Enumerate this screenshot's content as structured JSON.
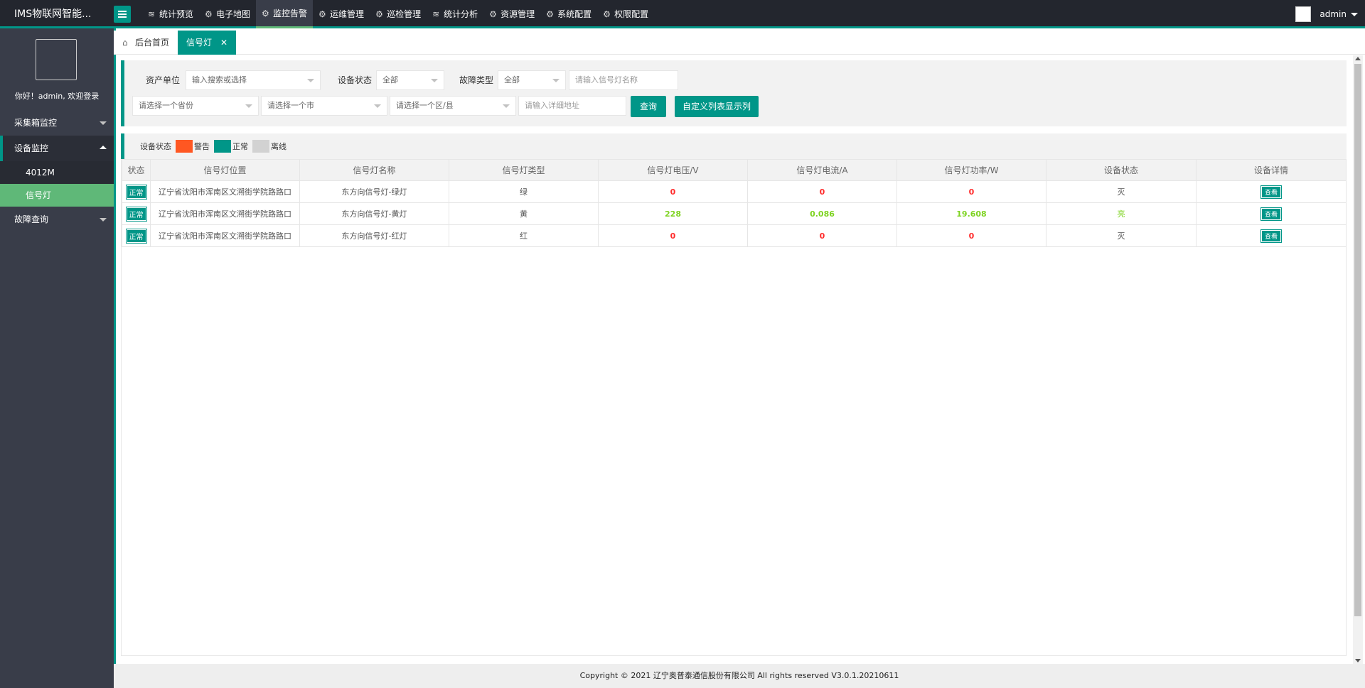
{
  "app": {
    "title": "IMS物联网智能..."
  },
  "nav": [
    {
      "label": "统计预览",
      "icon": "layers-icon"
    },
    {
      "label": "电子地图",
      "icon": "gear-icon"
    },
    {
      "label": "监控告警",
      "icon": "gear-icon",
      "active": true
    },
    {
      "label": "运维管理",
      "icon": "gear-icon"
    },
    {
      "label": "巡检管理",
      "icon": "gear-icon"
    },
    {
      "label": "统计分析",
      "icon": "layers-icon"
    },
    {
      "label": "资源管理",
      "icon": "gear-icon"
    },
    {
      "label": "系统配置",
      "icon": "gear-icon"
    },
    {
      "label": "权限配置",
      "icon": "gear-icon"
    }
  ],
  "user": {
    "name": "admin"
  },
  "sidebar": {
    "welcome": "你好！admin, 欢迎登录",
    "items": [
      {
        "label": "采集箱监控"
      },
      {
        "label": "设备监控",
        "open": true,
        "children": [
          {
            "label": "4012M"
          },
          {
            "label": "信号灯",
            "active": true
          }
        ]
      },
      {
        "label": "故障查询"
      }
    ]
  },
  "tabs": {
    "home": "后台首页",
    "active": "信号灯"
  },
  "filters": {
    "asset_label": "资产单位",
    "asset_placeholder": "输入搜索或选择",
    "status_label": "设备状态",
    "status_value": "全部",
    "fault_label": "故障类型",
    "fault_value": "全部",
    "name_placeholder": "请输入信号灯名称",
    "province_placeholder": "请选择一个省份",
    "city_placeholder": "请选择一个市",
    "district_placeholder": "请选择一个区/县",
    "address_placeholder": "请输入详细地址",
    "query_button": "查询",
    "custom_columns_button": "自定义列表显示列"
  },
  "legend": {
    "label": "设备状态",
    "items": [
      {
        "label": "警告",
        "color": "#ff5722"
      },
      {
        "label": "正常",
        "color": "#009688"
      },
      {
        "label": "离线",
        "color": "#d2d2d2"
      }
    ]
  },
  "table": {
    "headers": [
      "状态",
      "信号灯位置",
      "信号灯名称",
      "信号灯类型",
      "信号灯电压/V",
      "信号灯电流/A",
      "信号灯功率/W",
      "设备状态",
      "设备详情"
    ],
    "rows": [
      {
        "status": "正常",
        "location": "辽宁省沈阳市浑南区文溯街学院路路口",
        "name": "东方向信号灯-绿灯",
        "type": "绿",
        "voltage": "0",
        "current": "0",
        "power": "0",
        "device_state": "灭",
        "detail": "查看"
      },
      {
        "status": "正常",
        "location": "辽宁省沈阳市浑南区文溯街学院路路口",
        "name": "东方向信号灯-黄灯",
        "type": "黄",
        "voltage": "228",
        "current": "0.086",
        "power": "19.608",
        "device_state": "亮",
        "detail": "查看"
      },
      {
        "status": "正常",
        "location": "辽宁省沈阳市浑南区文溯街学院路路口",
        "name": "东方向信号灯-红灯",
        "type": "红",
        "voltage": "0",
        "current": "0",
        "power": "0",
        "device_state": "灭",
        "detail": "查看"
      }
    ]
  },
  "footer": {
    "text": "Copyright © 2021 辽宁奥普泰通信股份有限公司 All rights reserved V3.0.1.20210611"
  }
}
